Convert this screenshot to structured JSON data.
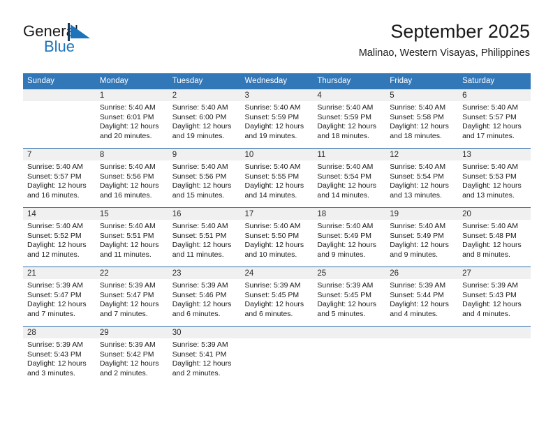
{
  "brand": {
    "name_part1": "General",
    "name_part2": "Blue",
    "mark": "flag-triangle-icon",
    "accent_color": "#1d74bb"
  },
  "header": {
    "title": "September 2025",
    "subtitle": "Malinao, Western Visayas, Philippines"
  },
  "theme": {
    "header_bg": "#3277b8",
    "row_divider": "#2f6fad",
    "daynum_band": "#f0f0f0"
  },
  "weekdays": [
    "Sunday",
    "Monday",
    "Tuesday",
    "Wednesday",
    "Thursday",
    "Friday",
    "Saturday"
  ],
  "weeks": [
    [
      {
        "day": "",
        "empty": true
      },
      {
        "day": "1",
        "sunrise": "Sunrise: 5:40 AM",
        "sunset": "Sunset: 6:01 PM",
        "daylight": "Daylight: 12 hours and 20 minutes."
      },
      {
        "day": "2",
        "sunrise": "Sunrise: 5:40 AM",
        "sunset": "Sunset: 6:00 PM",
        "daylight": "Daylight: 12 hours and 19 minutes."
      },
      {
        "day": "3",
        "sunrise": "Sunrise: 5:40 AM",
        "sunset": "Sunset: 5:59 PM",
        "daylight": "Daylight: 12 hours and 19 minutes."
      },
      {
        "day": "4",
        "sunrise": "Sunrise: 5:40 AM",
        "sunset": "Sunset: 5:59 PM",
        "daylight": "Daylight: 12 hours and 18 minutes."
      },
      {
        "day": "5",
        "sunrise": "Sunrise: 5:40 AM",
        "sunset": "Sunset: 5:58 PM",
        "daylight": "Daylight: 12 hours and 18 minutes."
      },
      {
        "day": "6",
        "sunrise": "Sunrise: 5:40 AM",
        "sunset": "Sunset: 5:57 PM",
        "daylight": "Daylight: 12 hours and 17 minutes."
      }
    ],
    [
      {
        "day": "7",
        "sunrise": "Sunrise: 5:40 AM",
        "sunset": "Sunset: 5:57 PM",
        "daylight": "Daylight: 12 hours and 16 minutes."
      },
      {
        "day": "8",
        "sunrise": "Sunrise: 5:40 AM",
        "sunset": "Sunset: 5:56 PM",
        "daylight": "Daylight: 12 hours and 16 minutes."
      },
      {
        "day": "9",
        "sunrise": "Sunrise: 5:40 AM",
        "sunset": "Sunset: 5:56 PM",
        "daylight": "Daylight: 12 hours and 15 minutes."
      },
      {
        "day": "10",
        "sunrise": "Sunrise: 5:40 AM",
        "sunset": "Sunset: 5:55 PM",
        "daylight": "Daylight: 12 hours and 14 minutes."
      },
      {
        "day": "11",
        "sunrise": "Sunrise: 5:40 AM",
        "sunset": "Sunset: 5:54 PM",
        "daylight": "Daylight: 12 hours and 14 minutes."
      },
      {
        "day": "12",
        "sunrise": "Sunrise: 5:40 AM",
        "sunset": "Sunset: 5:54 PM",
        "daylight": "Daylight: 12 hours and 13 minutes."
      },
      {
        "day": "13",
        "sunrise": "Sunrise: 5:40 AM",
        "sunset": "Sunset: 5:53 PM",
        "daylight": "Daylight: 12 hours and 13 minutes."
      }
    ],
    [
      {
        "day": "14",
        "sunrise": "Sunrise: 5:40 AM",
        "sunset": "Sunset: 5:52 PM",
        "daylight": "Daylight: 12 hours and 12 minutes."
      },
      {
        "day": "15",
        "sunrise": "Sunrise: 5:40 AM",
        "sunset": "Sunset: 5:51 PM",
        "daylight": "Daylight: 12 hours and 11 minutes."
      },
      {
        "day": "16",
        "sunrise": "Sunrise: 5:40 AM",
        "sunset": "Sunset: 5:51 PM",
        "daylight": "Daylight: 12 hours and 11 minutes."
      },
      {
        "day": "17",
        "sunrise": "Sunrise: 5:40 AM",
        "sunset": "Sunset: 5:50 PM",
        "daylight": "Daylight: 12 hours and 10 minutes."
      },
      {
        "day": "18",
        "sunrise": "Sunrise: 5:40 AM",
        "sunset": "Sunset: 5:49 PM",
        "daylight": "Daylight: 12 hours and 9 minutes."
      },
      {
        "day": "19",
        "sunrise": "Sunrise: 5:40 AM",
        "sunset": "Sunset: 5:49 PM",
        "daylight": "Daylight: 12 hours and 9 minutes."
      },
      {
        "day": "20",
        "sunrise": "Sunrise: 5:40 AM",
        "sunset": "Sunset: 5:48 PM",
        "daylight": "Daylight: 12 hours and 8 minutes."
      }
    ],
    [
      {
        "day": "21",
        "sunrise": "Sunrise: 5:39 AM",
        "sunset": "Sunset: 5:47 PM",
        "daylight": "Daylight: 12 hours and 7 minutes."
      },
      {
        "day": "22",
        "sunrise": "Sunrise: 5:39 AM",
        "sunset": "Sunset: 5:47 PM",
        "daylight": "Daylight: 12 hours and 7 minutes."
      },
      {
        "day": "23",
        "sunrise": "Sunrise: 5:39 AM",
        "sunset": "Sunset: 5:46 PM",
        "daylight": "Daylight: 12 hours and 6 minutes."
      },
      {
        "day": "24",
        "sunrise": "Sunrise: 5:39 AM",
        "sunset": "Sunset: 5:45 PM",
        "daylight": "Daylight: 12 hours and 6 minutes."
      },
      {
        "day": "25",
        "sunrise": "Sunrise: 5:39 AM",
        "sunset": "Sunset: 5:45 PM",
        "daylight": "Daylight: 12 hours and 5 minutes."
      },
      {
        "day": "26",
        "sunrise": "Sunrise: 5:39 AM",
        "sunset": "Sunset: 5:44 PM",
        "daylight": "Daylight: 12 hours and 4 minutes."
      },
      {
        "day": "27",
        "sunrise": "Sunrise: 5:39 AM",
        "sunset": "Sunset: 5:43 PM",
        "daylight": "Daylight: 12 hours and 4 minutes."
      }
    ],
    [
      {
        "day": "28",
        "sunrise": "Sunrise: 5:39 AM",
        "sunset": "Sunset: 5:43 PM",
        "daylight": "Daylight: 12 hours and 3 minutes."
      },
      {
        "day": "29",
        "sunrise": "Sunrise: 5:39 AM",
        "sunset": "Sunset: 5:42 PM",
        "daylight": "Daylight: 12 hours and 2 minutes."
      },
      {
        "day": "30",
        "sunrise": "Sunrise: 5:39 AM",
        "sunset": "Sunset: 5:41 PM",
        "daylight": "Daylight: 12 hours and 2 minutes."
      },
      {
        "day": "",
        "empty": true
      },
      {
        "day": "",
        "empty": true
      },
      {
        "day": "",
        "empty": true
      },
      {
        "day": "",
        "empty": true
      }
    ]
  ]
}
